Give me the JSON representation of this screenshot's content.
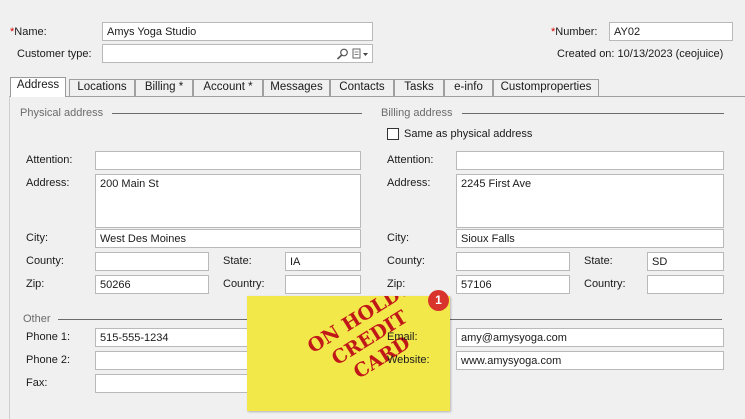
{
  "header": {
    "name_label": "Name:",
    "name_value": "Amys Yoga Studio",
    "customer_type_label": "Customer type:",
    "customer_type_value": "",
    "number_label": "Number:",
    "number_value": "AY02",
    "created_on": "Created on: 10/13/2023 (ceojuice)"
  },
  "tabs": [
    {
      "label": "Address"
    },
    {
      "label": "Locations"
    },
    {
      "label": "Billing  *"
    },
    {
      "label": "Account *"
    },
    {
      "label": "Messages"
    },
    {
      "label": "Contacts"
    },
    {
      "label": "Tasks"
    },
    {
      "label": "e-info"
    },
    {
      "label": "Customproperties"
    }
  ],
  "physical": {
    "section": "Physical address",
    "attention_label": "Attention:",
    "attention": "",
    "address_label": "Address:",
    "address": "200 Main St",
    "city_label": "City:",
    "city": "West Des Moines",
    "county_label": "County:",
    "county": "",
    "state_label": "State:",
    "state": "IA",
    "zip_label": "Zip:",
    "zip": "50266",
    "country_label": "Country:",
    "country": ""
  },
  "billing": {
    "section": "Billing address",
    "same_label": "Same as physical address",
    "same_checked": false,
    "attention_label": "Attention:",
    "attention": "",
    "address_label": "Address:",
    "address": "2245 First Ave",
    "city_label": "City:",
    "city": "Sioux Falls",
    "county_label": "County:",
    "county": "",
    "state_label": "State:",
    "state": "SD",
    "zip_label": "Zip:",
    "zip": "57106",
    "country_label": "Country:",
    "country": ""
  },
  "other": {
    "section": "Other",
    "phone1_label": "Phone 1:",
    "phone1": "515-555-1234",
    "phone2_label": "Phone 2:",
    "phone2": "",
    "fax_label": "Fax:",
    "fax": "",
    "email_label": "Email:",
    "email": "amy@amysyoga.com",
    "website_label": "Website:",
    "website": "www.amysyoga.com"
  },
  "sticky_note": {
    "line1": "ON HOLD!",
    "line2": "CREDIT",
    "line3": "CARD",
    "badge": "1",
    "color": "#f3e84a",
    "text_color": "#c01818"
  },
  "icons": {
    "search": "search-icon",
    "lookup": "lookup-dropdown-icon",
    "badge_color": "#d9342b"
  }
}
